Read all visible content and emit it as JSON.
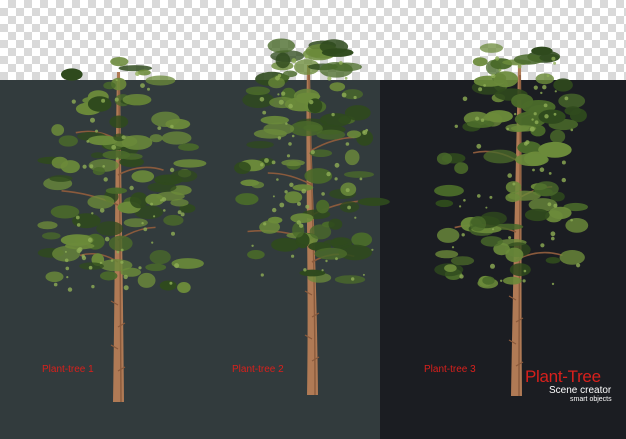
{
  "tree_labels": [
    "Plant-tree 1",
    "Plant-tree 2",
    "Plant-tree 3"
  ],
  "brand": {
    "title": "Plant-Tree",
    "subtitle": "Scene creator",
    "tagline": "smart objects"
  },
  "colors": {
    "accent_red": "#d8201c",
    "panel_left": "#323b3d",
    "panel_right": "#1b1d22",
    "foliage_dark": "#2f4a1d",
    "foliage_mid": "#4a6a2a",
    "foliage_light": "#6b8a3a",
    "trunk": "#b07a55"
  },
  "icons": [
    "transparency-checkerboard"
  ]
}
